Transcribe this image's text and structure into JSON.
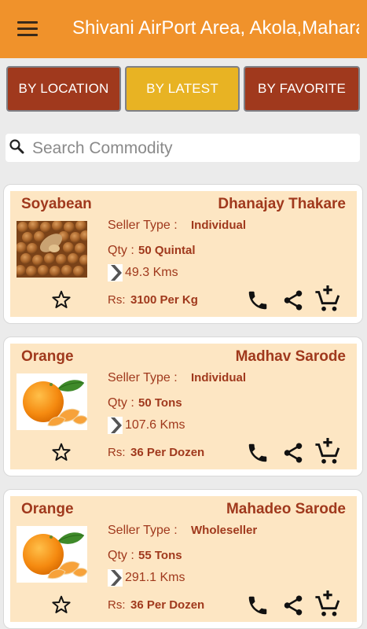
{
  "header": {
    "title": "Shivani AirPort Area, Akola,Maharashtra"
  },
  "tabs": [
    "BY LOCATION",
    "BY LATEST",
    "BY FAVORITE"
  ],
  "colors": {
    "brand": "#f0922b",
    "tab_inactive": "#a0391d",
    "tab_active": "#e8b323",
    "card_bg": "#fde6c3",
    "text_accent": "#a0391d"
  },
  "search": {
    "placeholder": "Search Commodity",
    "icon": "search-icon"
  },
  "labels": {
    "seller_type": "Seller Type :",
    "qty": "Qty :",
    "rs": "Rs:"
  },
  "icons": [
    "menu-icon",
    "star-icon",
    "chevron-right-icon",
    "call-icon",
    "share-icon",
    "add-to-cart-icon"
  ],
  "listings": [
    {
      "commodity": "Soyabean",
      "seller": "Dhanajay Thakare",
      "seller_type": "Individual",
      "qty": "50 Quintal",
      "distance": "49.3 Kms",
      "price": "3100 Per Kg"
    },
    {
      "commodity": "Orange",
      "seller": "Madhav Sarode",
      "seller_type": "Individual",
      "qty": "50 Tons",
      "distance": "107.6 Kms",
      "price": "36 Per Dozen"
    },
    {
      "commodity": "Orange",
      "seller": "Mahadeo Sarode",
      "seller_type": "Wholeseller",
      "qty": "55 Tons",
      "distance": "291.1 Kms",
      "price": "36 Per Dozen"
    }
  ]
}
